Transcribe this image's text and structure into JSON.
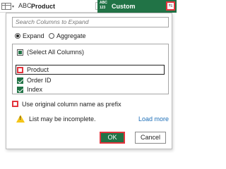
{
  "header": {
    "column_product": {
      "type_icon": "ABC",
      "name": "Product"
    },
    "column_custom": {
      "type_icon_top": "ABC",
      "type_icon_bottom": "123",
      "name": "Custom"
    },
    "expand_icon": "expand-arrows-icon",
    "accent_color": "#217346"
  },
  "popup": {
    "search_placeholder": "Search Columns to Expand",
    "mode_options": [
      {
        "label": "Expand",
        "selected": true
      },
      {
        "label": "Aggregate",
        "selected": false
      }
    ],
    "columns": [
      {
        "label": "(Select All Columns)",
        "state": "partial"
      },
      {
        "label": "Product",
        "state": "unchecked"
      },
      {
        "label": "Order ID",
        "state": "checked"
      },
      {
        "label": "Index",
        "state": "checked"
      }
    ],
    "prefix_label": "Use original column name as prefix",
    "prefix_checked": false,
    "warning_text": "List may be incomplete.",
    "load_more_label": "Load more",
    "ok_label": "OK",
    "cancel_label": "Cancel"
  }
}
